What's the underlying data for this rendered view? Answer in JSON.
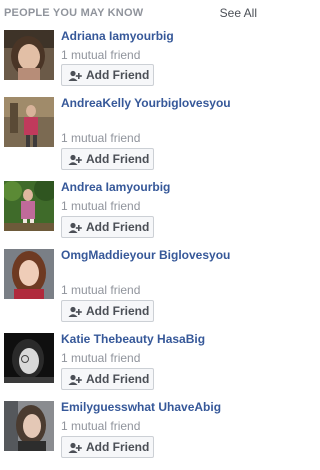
{
  "header": {
    "title": "PEOPLE YOU MAY KNOW",
    "see_all": "See All"
  },
  "people": [
    {
      "name": "Adriana Iamyourbig",
      "mutual": "1 mutual friend",
      "button": "Add Friend"
    },
    {
      "name": "AndreaKelly Yourbiglovesyou",
      "mutual": "1 mutual friend",
      "button": "Add Friend"
    },
    {
      "name": "Andrea Iamyourbig",
      "mutual": "1 mutual friend",
      "button": "Add Friend"
    },
    {
      "name": "OmgMaddieyour Biglovesyou",
      "mutual": "1 mutual friend",
      "button": "Add Friend"
    },
    {
      "name": "Katie Thebeauty HasaBig",
      "mutual": "1 mutual friend",
      "button": "Add Friend"
    },
    {
      "name": "Emilyguesswhat UhaveAbig",
      "mutual": "1 mutual friend",
      "button": "Add Friend"
    }
  ]
}
